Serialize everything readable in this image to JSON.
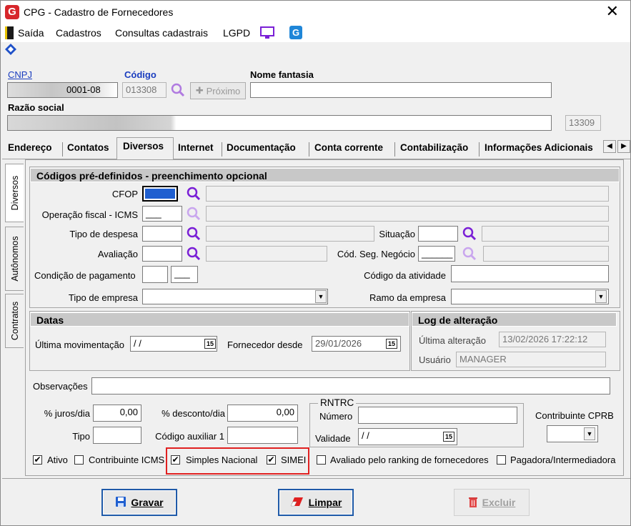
{
  "window": {
    "title": "CPG - Cadastro de Fornecedores",
    "close_symbol": "✕",
    "logo_letter": "G"
  },
  "menu": {
    "saida": "Saída",
    "cadastros": "Cadastros",
    "consultas": "Consultas cadastrais",
    "lgpd": "LGPD"
  },
  "header": {
    "cnpj_label": "CNPJ",
    "cnpj_value": "0001-08",
    "codigo_label": "Código",
    "codigo_value": "013308",
    "proximo_label": "Próximo",
    "nome_fantasia_label": "Nome fantasia",
    "nome_fantasia_value": "",
    "razao_social_label": "Razão social",
    "razao_social_value": "",
    "razao_code": "13309"
  },
  "tabs": [
    "Endereço",
    "Contatos",
    "Diversos",
    "Internet",
    "Documentação",
    "Conta corrente",
    "Contabilização",
    "Informações Adicionais"
  ],
  "active_tab": "Diversos",
  "side_tabs": [
    "Diversos",
    "Autônomos",
    "Contratos"
  ],
  "codigos": {
    "title": "Códigos pré-definidos - preenchimento opcional",
    "cfop": "CFOP",
    "operacao": "Operação fiscal - ICMS",
    "operacao_value": "___",
    "tipo_despesa": "Tipo de despesa",
    "situacao": "Situação",
    "avaliacao": "Avaliação",
    "cod_seg": "Cód. Seg. Negócio",
    "cod_seg_value": "______",
    "cond_pagamento": "Condição de pagamento",
    "cond_value2": "___",
    "codigo_atividade": "Código da atividade",
    "tipo_empresa": "Tipo de empresa",
    "ramo_empresa": "Ramo da empresa"
  },
  "datas": {
    "title": "Datas",
    "ultima_mov": "Última movimentação",
    "ultima_mov_value": "/ /",
    "fornecedor_desde": "Fornecedor desde",
    "fornecedor_desde_value": "29/01/2026",
    "cal_day": "15"
  },
  "log": {
    "title": "Log de alteração",
    "ultima_alteracao": "Última alteração",
    "ultima_alteracao_value": "13/02/2026 17:22:12",
    "usuario": "Usuário",
    "usuario_value": "MANAGER"
  },
  "bottom": {
    "observacoes": "Observações",
    "juros": "% juros/dia",
    "juros_value": "0,00",
    "desconto": "% desconto/dia",
    "desconto_value": "0,00",
    "tipo": "Tipo",
    "codigo_aux": "Código auxiliar 1",
    "rntrc": "RNTRC",
    "numero": "Número",
    "validade": "Validade",
    "validade_value": "/ /",
    "contribuinte_cprb": "Contribuinte CPRB"
  },
  "checks": {
    "ativo": "Ativo",
    "contribuinte_icms": "Contribuinte ICMS",
    "simples_nacional": "Simples Nacional",
    "simei": "SIMEI",
    "avaliado": "Avaliado pelo ranking de fornecedores",
    "pagadora": "Pagadora/Intermediadora",
    "check_mark": "✔"
  },
  "buttons": {
    "gravar": "Gravar",
    "limpar": "Limpar",
    "excluir": "Excluir"
  },
  "colors": {
    "accent_blue": "#1a3dbf",
    "search_purple": "#7a1fd6",
    "highlight_red": "#e02020"
  }
}
